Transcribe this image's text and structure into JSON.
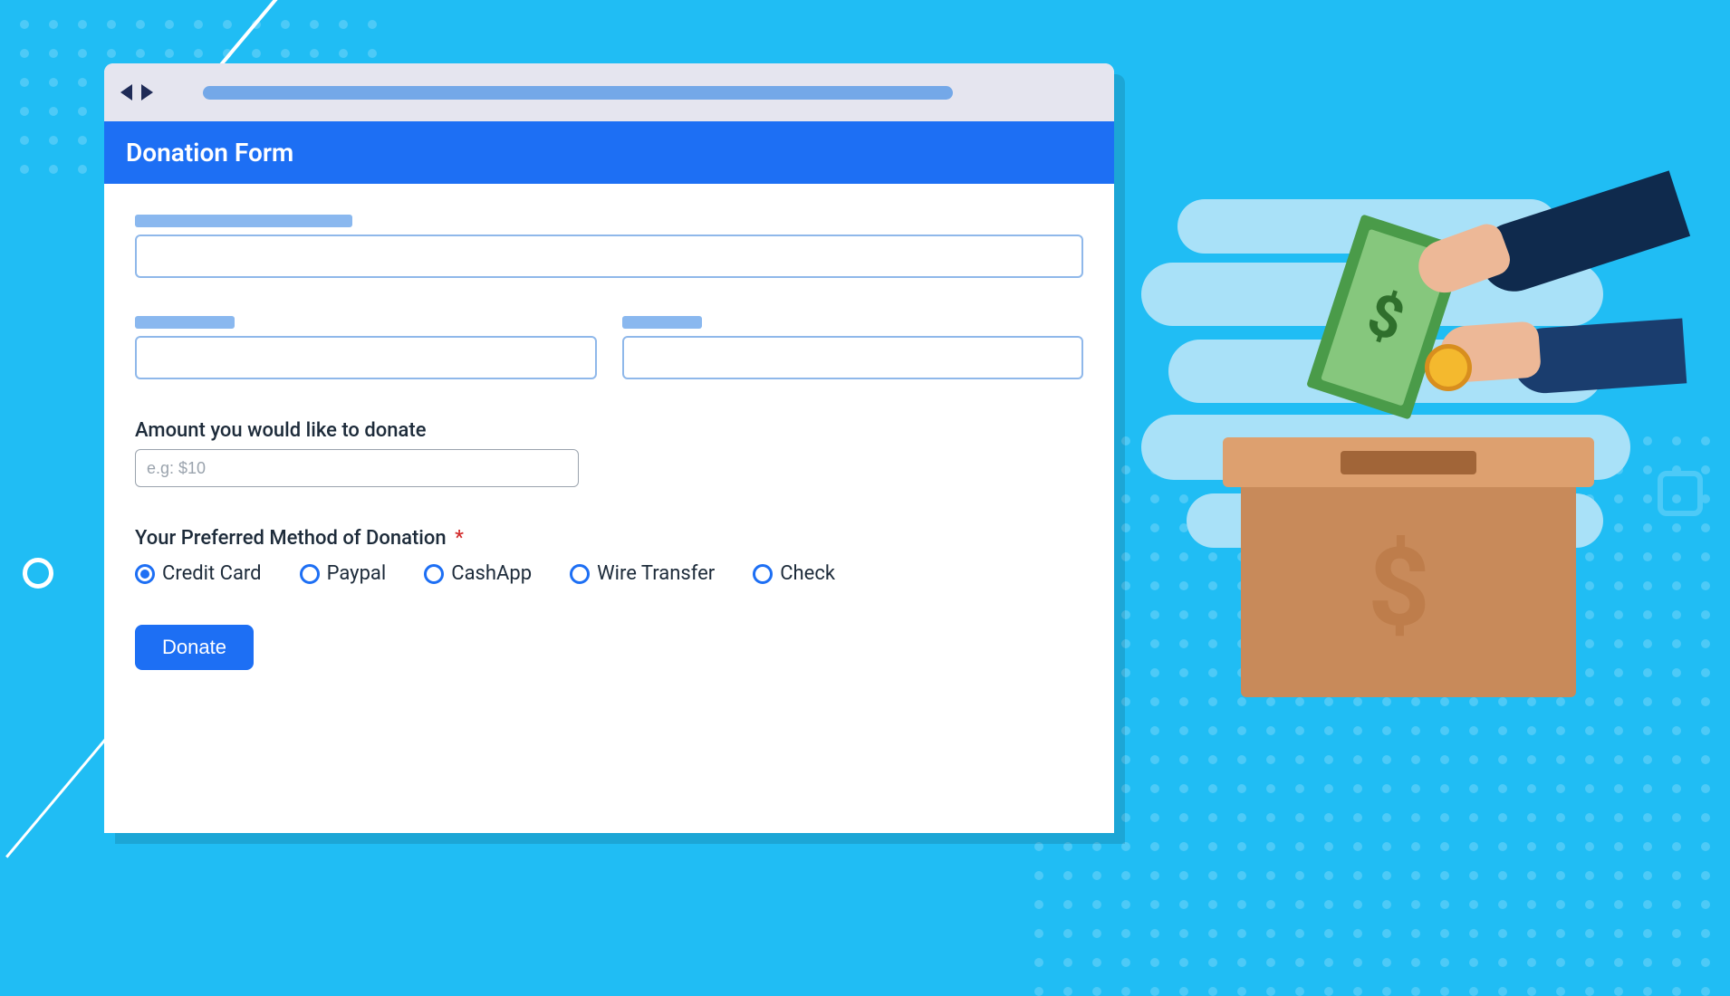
{
  "header": {
    "title": "Donation Form"
  },
  "fields": {
    "amount_label": "Amount you would like to donate",
    "amount_placeholder": "e.g: $10",
    "method_label": "Your Preferred Method of Donation",
    "method_required": "*"
  },
  "payment_methods": {
    "selected": "Credit Card",
    "options": [
      "Credit Card",
      "Paypal",
      "CashApp",
      "Wire Transfer",
      "Check"
    ]
  },
  "buttons": {
    "submit": "Donate"
  },
  "illustration": {
    "bill_symbol": "$",
    "box_symbol": "$"
  }
}
